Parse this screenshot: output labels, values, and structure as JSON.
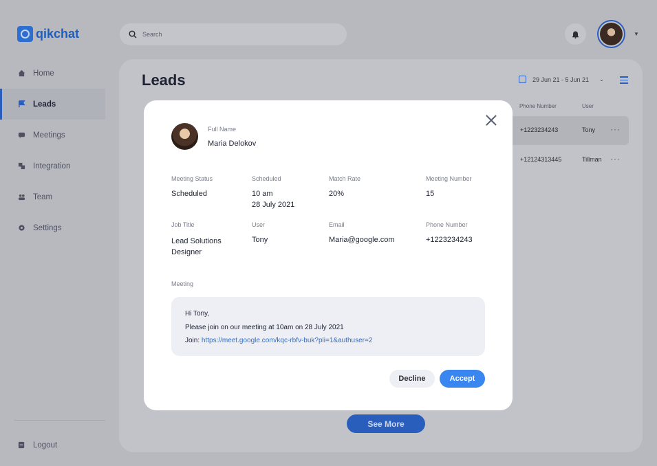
{
  "app": {
    "name": "qikchat"
  },
  "sidebar": {
    "items": [
      {
        "label": "Home",
        "icon": "home-icon"
      },
      {
        "label": "Leads",
        "icon": "flag-icon",
        "active": true
      },
      {
        "label": "Meetings",
        "icon": "chat-icon"
      },
      {
        "label": "Integration",
        "icon": "puzzle-icon"
      },
      {
        "label": "Team",
        "icon": "team-icon"
      },
      {
        "label": "Settings",
        "icon": "gear-icon"
      }
    ],
    "logout_label": "Logout"
  },
  "search": {
    "placeholder": "Search"
  },
  "header": {
    "title": "Leads",
    "date_range": "29 Jun 21 - 5 Jun 21"
  },
  "table": {
    "columns": [
      "Phone Number",
      "User"
    ],
    "rows": [
      {
        "phone": "+1223234243",
        "user": "Tony"
      },
      {
        "phone": "+12124313445",
        "user": "Tillman"
      }
    ],
    "row_menu": "···"
  },
  "see_more_label": "See More",
  "modal": {
    "full_name_label": "Full Name",
    "full_name": "Maria Delokov",
    "fields": {
      "meeting_status": {
        "label": "Meeting Status",
        "value": "Scheduled"
      },
      "scheduled": {
        "label": "Scheduled",
        "time": "10 am",
        "date": "28 July 2021"
      },
      "match_rate": {
        "label": "Match Rate",
        "value": "20%"
      },
      "meeting_number": {
        "label": "Meeting Number",
        "value": "15"
      },
      "job_title": {
        "label": "Job Title",
        "line1": "Lead Solutions",
        "line2": "Designer"
      },
      "user": {
        "label": "User",
        "value": "Tony"
      },
      "email": {
        "label": "Email",
        "value": "Maria@google.com"
      },
      "phone": {
        "label": "Phone Number",
        "value": "+1223234243"
      }
    },
    "meeting_label": "Meeting",
    "message": {
      "greeting": "Hi Tony,",
      "body": "Please join on our meeting at 10am on 28 July 2021",
      "join_prefix": "Join: ",
      "link": "https://meet.google.com/kqc-rbfv-buk?pli=1&authuser=2"
    },
    "decline_label": "Decline",
    "accept_label": "Accept"
  },
  "colors": {
    "accent": "#2a5ebd",
    "accept": "#3a86f0",
    "overlay": "#b8b9bf"
  }
}
